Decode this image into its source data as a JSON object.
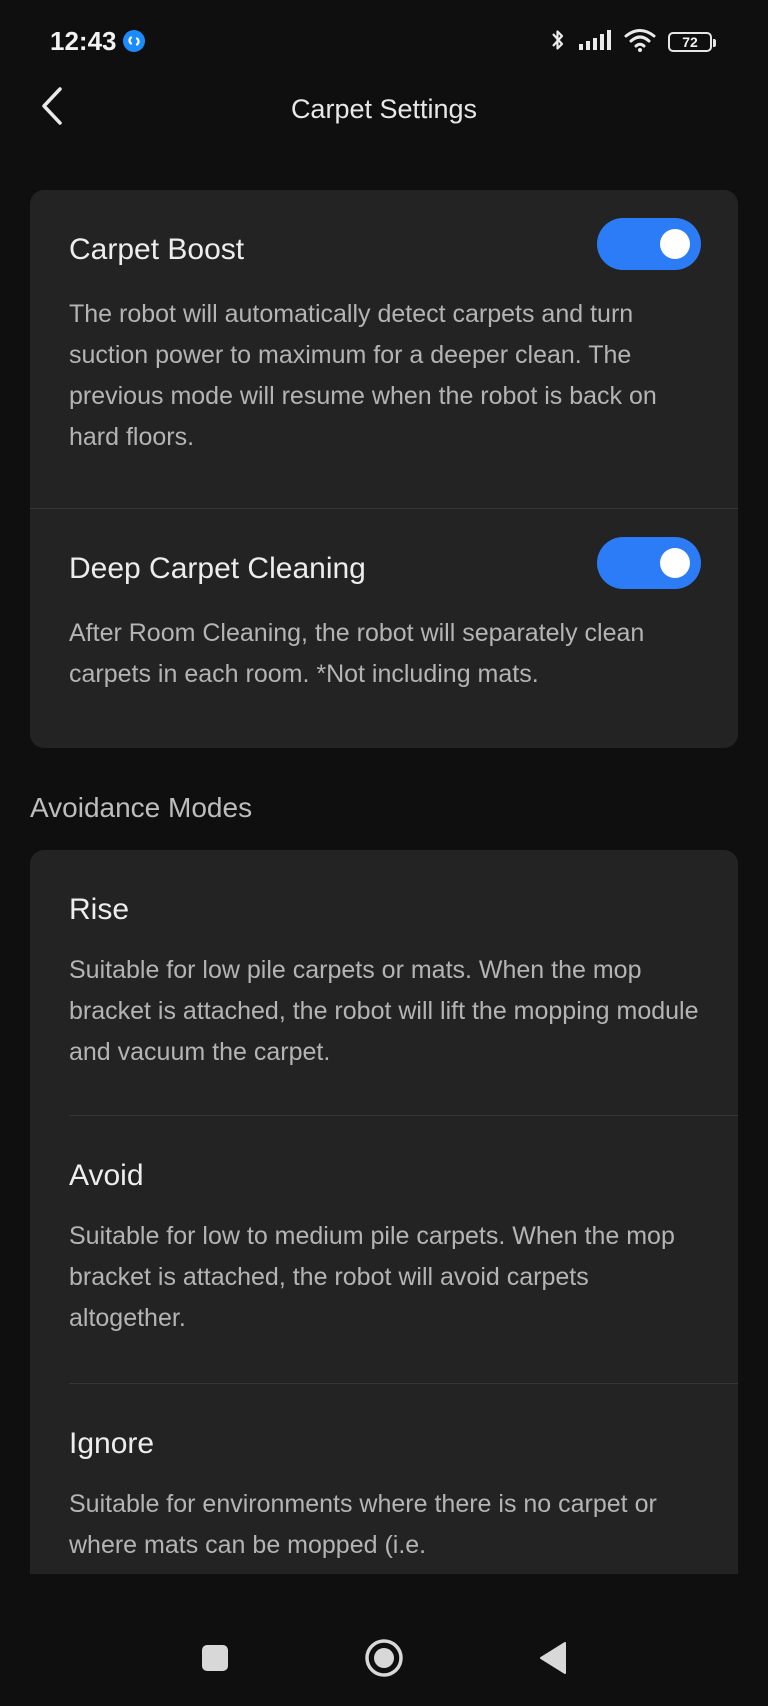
{
  "status_bar": {
    "time": "12:43",
    "battery": "72"
  },
  "header": {
    "title": "Carpet Settings"
  },
  "carpet_settings": {
    "items": [
      {
        "title": "Carpet Boost",
        "description": "The robot will automatically detect carpets and turn suction power to maximum for a deeper clean. The previous mode will resume when the robot is back on hard floors.",
        "enabled": true
      },
      {
        "title": "Deep Carpet Cleaning",
        "description": "After Room Cleaning, the robot will separately clean carpets in each room. *Not including mats.",
        "enabled": true
      }
    ]
  },
  "avoidance": {
    "section_label": "Avoidance Modes",
    "modes": [
      {
        "title": "Rise",
        "description": "Suitable for low pile carpets or mats. When the mop bracket is attached, the robot will lift the mopping module and vacuum the carpet."
      },
      {
        "title": "Avoid",
        "description": "Suitable for low to medium pile carpets. When the mop bracket is attached, the robot will avoid carpets altogether."
      },
      {
        "title": "Ignore",
        "description": "Suitable for environments where there is no carpet or where mats can be mopped (i.e."
      }
    ]
  },
  "colors": {
    "background": "#0f0f0f",
    "card": "#232323",
    "accent": "#2b7cf6"
  }
}
